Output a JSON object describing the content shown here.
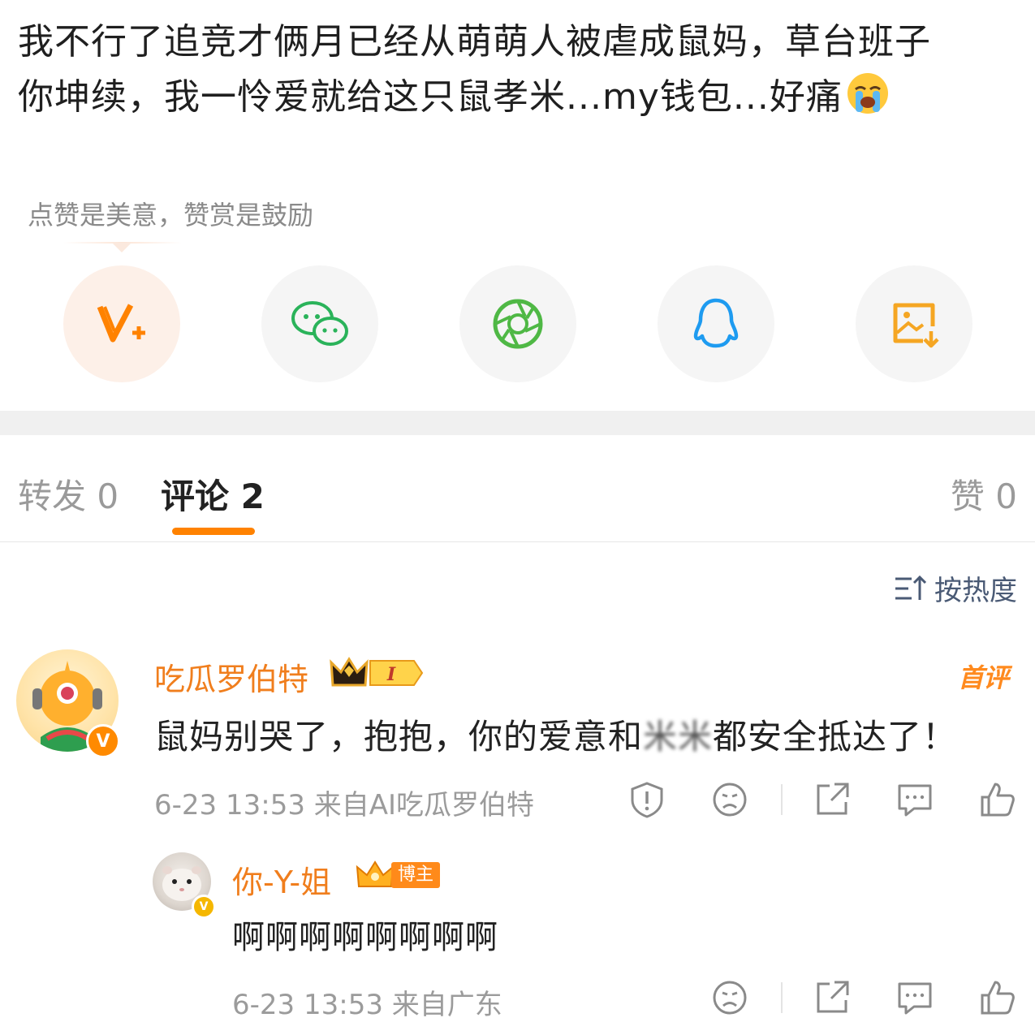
{
  "post": {
    "text_line1": "我不行了追竞才俩月已经从萌萌人被虐成鼠妈，草台班子",
    "text_line2": "你坤续，我一怜爱就给这只鼠孝米...my钱包...好痛",
    "emoji": "crying-face"
  },
  "reward": {
    "hint": "点赞是美意，赞赏是鼓励"
  },
  "share_buttons": [
    {
      "name": "v-plus",
      "color": "#ff8200"
    },
    {
      "name": "wechat",
      "color": "#2ab35a"
    },
    {
      "name": "moments",
      "color": "#4fb845"
    },
    {
      "name": "qq",
      "color": "#1e9bf0"
    },
    {
      "name": "save-image",
      "color": "#f5a623"
    }
  ],
  "tabs": {
    "repost": "转发 0",
    "comments": "评论 2",
    "likes": "赞 0"
  },
  "sort": {
    "label": "按热度"
  },
  "comments": [
    {
      "username": "吃瓜罗伯特",
      "level_badge": "I",
      "first_tag": "首评",
      "text_before": "鼠妈别哭了，抱抱，你的爱意和",
      "text_blurred": "米米",
      "text_after": "都安全抵达了！",
      "meta": "6-23 13:53 来自AI吃瓜罗伯特",
      "verified_badge": "V"
    },
    {
      "username": "你-Y-姐",
      "role_badge": "博主",
      "text": "啊啊啊啊啊啊啊啊",
      "meta": "6-23 13:53 来自广东",
      "verified_badge": "V"
    }
  ],
  "colors": {
    "accent": "#ff8200",
    "username": "#f07e1d",
    "meta": "#9b9b9b",
    "divider": "#f0f0f0"
  }
}
